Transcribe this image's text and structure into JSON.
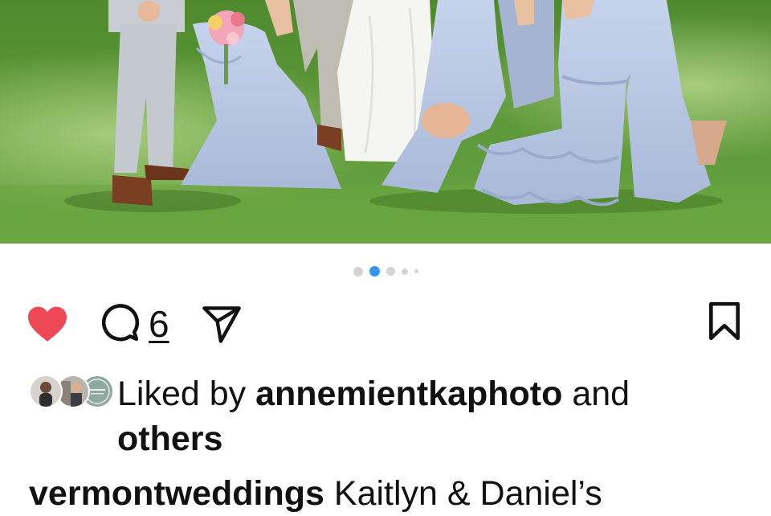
{
  "post": {
    "photo_alt": "",
    "carousel": {
      "total": 5,
      "active_index": 1
    },
    "actions": {
      "like_icon": "heart-filled-icon",
      "liked": true,
      "comment_icon": "comment-bubble-icon",
      "comment_count": "6",
      "share_icon": "paper-plane-icon",
      "save_icon": "bookmark-icon"
    },
    "likes": {
      "prefix": "Liked by ",
      "user": "annemientkaphoto",
      "joiner": " and",
      "suffix": "others"
    },
    "caption": {
      "username": "vermontweddings",
      "text": " Kaitlyn & Daniel’s"
    }
  },
  "colors": {
    "like_red": "#ed4956",
    "active_dot": "#3797f0",
    "inactive_dot": "#d4d4d4",
    "grass": "#5f9a3a",
    "dress_blue": "#b9c7e2"
  }
}
